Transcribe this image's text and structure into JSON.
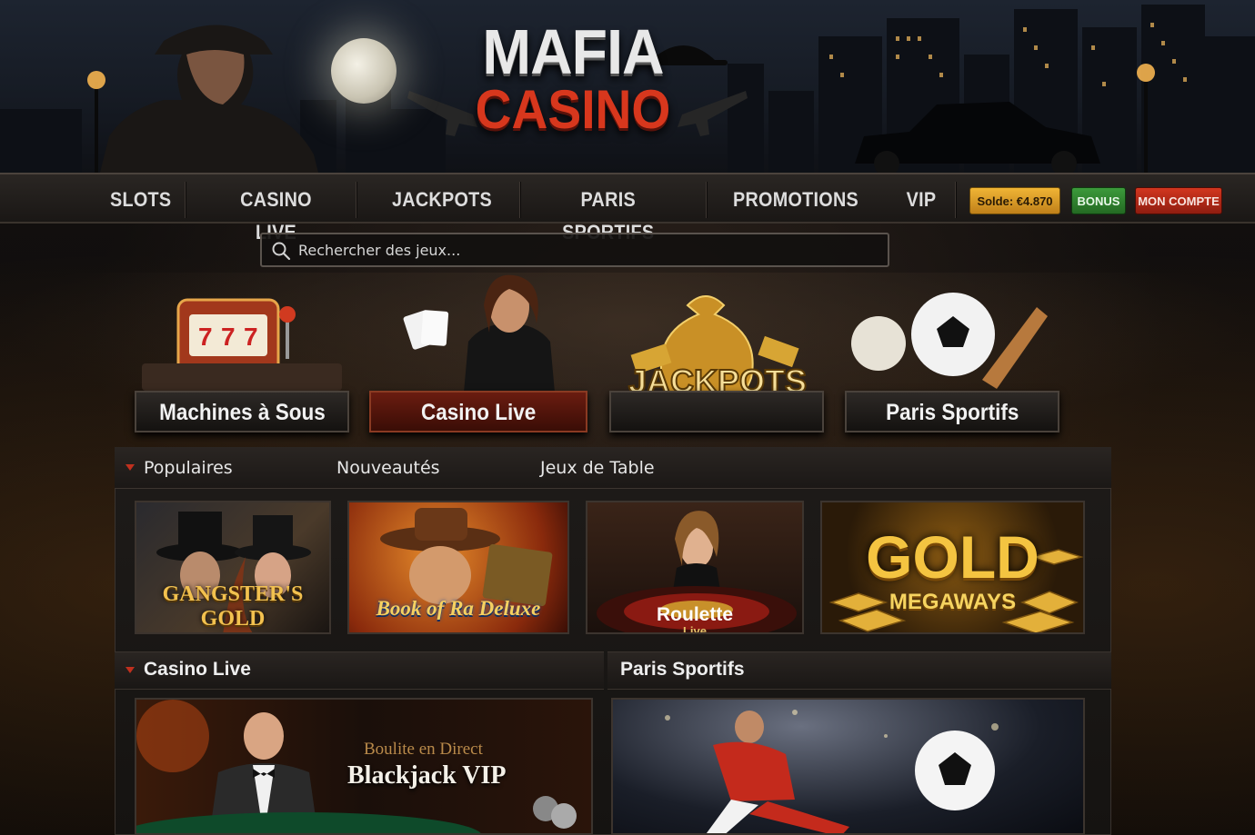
{
  "brand": {
    "logo_top": "MAFIA",
    "logo_bottom": "CASINO",
    "accent_red": "#d7371d",
    "gold": "#e3b03a"
  },
  "nav": {
    "items": [
      "SLOTS",
      "CASINO LIVE",
      "JACKPOTS",
      "PARIS SPORTIFS",
      "PROMOTIONS",
      "VIP"
    ],
    "balance": "Solde: €4.870",
    "bonus": "BONUS",
    "account": "MON COMPTE"
  },
  "search": {
    "placeholder": "Rechercher des jeux...",
    "icon": "search-icon"
  },
  "categories": [
    {
      "label": "Machines à Sous",
      "icon": "slot-machine",
      "active": false
    },
    {
      "label": "Casino Live",
      "icon": "live-dealer",
      "active": true
    },
    {
      "label": "",
      "banner_text": "JACKPOTS",
      "icon": "money-bag",
      "active": false
    },
    {
      "label": "Paris Sportifs",
      "icon": "sports-balls",
      "active": false
    }
  ],
  "tabs": [
    "Populaires",
    "Nouveautés",
    "Jeux de Table"
  ],
  "games": [
    {
      "title": "GANGSTER'S GOLD",
      "subtitle": ""
    },
    {
      "title": "Book of Ra Deluxe",
      "subtitle": ""
    },
    {
      "title": "Roulette",
      "subtitle": "Live"
    },
    {
      "title": "GOLD",
      "subtitle": "MEGAWAYS"
    }
  ],
  "sections": {
    "live": {
      "title": "Casino Live",
      "tile_kicker": "Boulite en Direct",
      "tile_title": "Blackjack VIP"
    },
    "sports": {
      "title": "Paris Sportifs"
    }
  }
}
